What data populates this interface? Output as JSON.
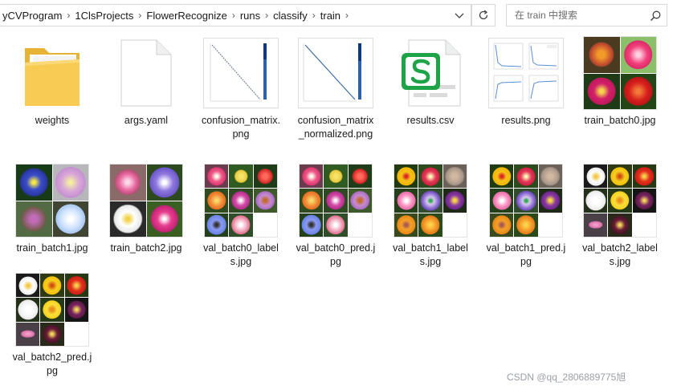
{
  "address_bar": {
    "crumbs": [
      "yCVProgram",
      "1ClsProjects",
      "FlowerRecognize",
      "runs",
      "classify",
      "train"
    ]
  },
  "search": {
    "placeholder": "在 train 中搜索"
  },
  "files": [
    {
      "name": "weights",
      "kind": "folder-icon"
    },
    {
      "name": "args.yaml",
      "kind": "yaml-file-icon"
    },
    {
      "name": "confusion_matrix.png",
      "kind": "image-thumbnail"
    },
    {
      "name": "confusion_matrix_normalized.png",
      "kind": "image-thumbnail"
    },
    {
      "name": "results.csv",
      "kind": "csv-file-icon"
    },
    {
      "name": "results.png",
      "kind": "image-thumbnail"
    },
    {
      "name": "train_batch0.jpg",
      "kind": "photo-grid"
    },
    {
      "name": "train_batch1.jpg",
      "kind": "photo-grid"
    },
    {
      "name": "train_batch2.jpg",
      "kind": "photo-grid"
    },
    {
      "name": "val_batch0_labels.jpg",
      "kind": "photo-grid"
    },
    {
      "name": "val_batch0_pred.jpg",
      "kind": "photo-grid"
    },
    {
      "name": "val_batch1_labels.jpg",
      "kind": "photo-grid"
    },
    {
      "name": "val_batch1_pred.jpg",
      "kind": "photo-grid"
    },
    {
      "name": "val_batch2_labels.jpg",
      "kind": "photo-grid"
    },
    {
      "name": "val_batch2_pred.jpg",
      "kind": "photo-grid"
    }
  ],
  "watermark": "CSDN @qq_2806889775旭",
  "colors": {
    "folder": "#f7c94b",
    "csv_brand": "#1fa347",
    "border": "#d9d9d9"
  }
}
